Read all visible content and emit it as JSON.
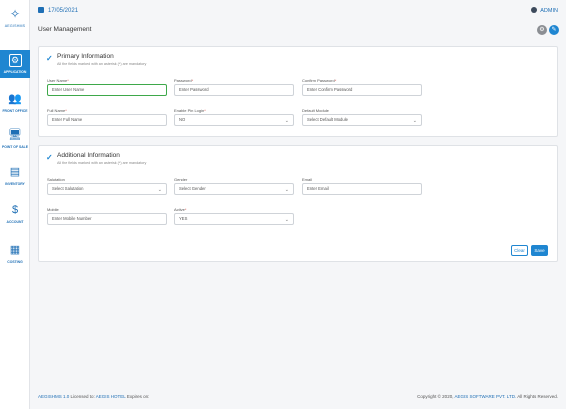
{
  "sidebar": {
    "logo_text": "AEGISHMS",
    "items": [
      {
        "label": "APPLICATION",
        "icon": "gear-window-icon",
        "active": true
      },
      {
        "label": "FRONT OFFICE",
        "icon": "people-icon",
        "active": false
      },
      {
        "label": "POINT OF SALE",
        "icon": "monitor-icon",
        "active": false
      },
      {
        "label": "INVENTORY",
        "icon": "store-icon",
        "active": false
      },
      {
        "label": "ACCOUNT",
        "icon": "dollar-icon",
        "active": false
      },
      {
        "label": "COSTING",
        "icon": "calculator-icon",
        "active": false
      }
    ]
  },
  "topbar": {
    "date": "17/05/2021",
    "user": "ADMIN"
  },
  "page": {
    "title": "User Management"
  },
  "primary": {
    "title": "Primary Information",
    "subtitle": "All the fields marked with an asterisk (*) are mandatory",
    "fields": {
      "username": {
        "label": "User Name",
        "placeholder": "Enter User Name",
        "required": true
      },
      "password": {
        "label": "Password",
        "placeholder": "Enter Password",
        "required": true
      },
      "confirm": {
        "label": "Confirm Password",
        "placeholder": "Enter Confirm Password",
        "required": true
      },
      "fullname": {
        "label": "Full Name",
        "placeholder": "Enter Full Name",
        "required": true
      },
      "pinlogin": {
        "label": "Enable Pin Login",
        "value": "NO",
        "required": true
      },
      "module": {
        "label": "Default Module",
        "value": "Select Default Module",
        "required": false
      }
    }
  },
  "additional": {
    "title": "Additional Information",
    "subtitle": "All the fields marked with an asterisk (*) are mandatory",
    "fields": {
      "salutation": {
        "label": "Salutation",
        "value": "Select Salutation"
      },
      "gender": {
        "label": "Gender",
        "value": "Select Gender"
      },
      "email": {
        "label": "Email",
        "placeholder": "Enter Email"
      },
      "mobile": {
        "label": "Mobile",
        "placeholder": "Enter Mobile Number"
      },
      "active": {
        "label": "Active",
        "value": "YES",
        "required": true
      }
    }
  },
  "buttons": {
    "clear": "Clear",
    "save": "Save"
  },
  "footer": {
    "product": "AEGISHMS 1.0",
    "licensed_to_prefix": " Licensed to: ",
    "licensee": "AEGIS HOTEL",
    "expires": " Expires on:",
    "copyright_prefix": "Copyright © 2020, ",
    "company": "AEGIS SOFTWARE PVT. LTD.",
    "rights": " All Rights Reserved."
  },
  "colors": {
    "accent": "#1f86d1",
    "focus": "#3ea84a",
    "required": "#d9534f"
  }
}
